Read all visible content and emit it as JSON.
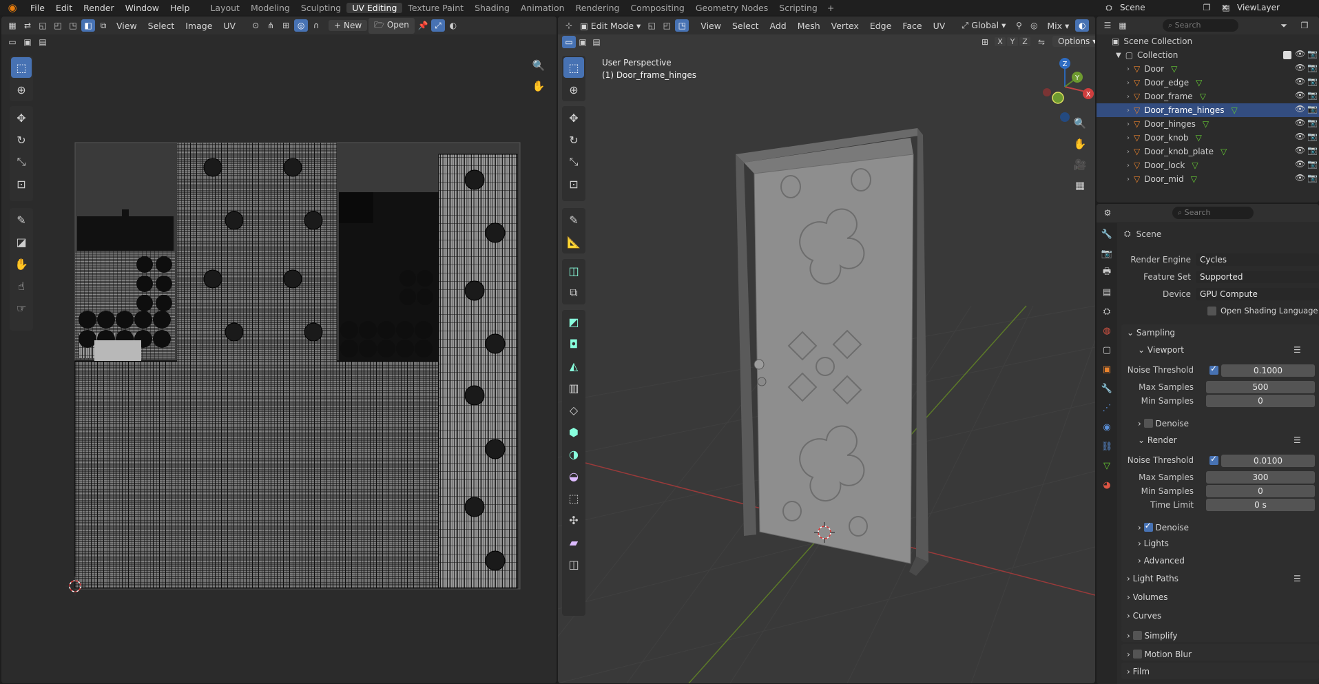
{
  "topbar": {
    "menus": [
      "File",
      "Edit",
      "Render",
      "Window",
      "Help"
    ],
    "workspaces": [
      {
        "label": "Layout",
        "active": false
      },
      {
        "label": "Modeling",
        "active": false
      },
      {
        "label": "Sculpting",
        "active": false
      },
      {
        "label": "UV Editing",
        "active": true
      },
      {
        "label": "Texture Paint",
        "active": false
      },
      {
        "label": "Shading",
        "active": false
      },
      {
        "label": "Animation",
        "active": false
      },
      {
        "label": "Rendering",
        "active": false
      },
      {
        "label": "Compositing",
        "active": false
      },
      {
        "label": "Geometry Nodes",
        "active": false
      },
      {
        "label": "Scripting",
        "active": false
      }
    ],
    "add_tab": "+",
    "scene": "Scene",
    "view_layer": "ViewLayer"
  },
  "uv_editor": {
    "menus": [
      "View",
      "Select",
      "Image",
      "UV"
    ],
    "new_label": "New",
    "open_label": "Open"
  },
  "viewport": {
    "mode": "Edit Mode",
    "menus": [
      "View",
      "Select",
      "Add",
      "Mesh",
      "Vertex",
      "Edge",
      "Face",
      "UV"
    ],
    "orientation": "Global",
    "mix": "Mix",
    "options": "Options",
    "axes": [
      "X",
      "Y",
      "Z"
    ],
    "perspective": "User Perspective",
    "object": "(1) Door_frame_hinges",
    "gizmo": {
      "x": "X",
      "y": "Y",
      "z": "Z"
    }
  },
  "outliner": {
    "search_placeholder": "Search",
    "scene_collection": "Scene Collection",
    "collection": "Collection",
    "items": [
      {
        "name": "Door",
        "selected": false
      },
      {
        "name": "Door_edge",
        "selected": false
      },
      {
        "name": "Door_frame",
        "selected": false
      },
      {
        "name": "Door_frame_hinges",
        "selected": true
      },
      {
        "name": "Door_hinges",
        "selected": false
      },
      {
        "name": "Door_knob",
        "selected": false
      },
      {
        "name": "Door_knob_plate",
        "selected": false
      },
      {
        "name": "Door_lock",
        "selected": false
      },
      {
        "name": "Door_mid",
        "selected": false
      }
    ]
  },
  "properties": {
    "search_placeholder": "Search",
    "context": "Scene",
    "render_engine_label": "Render Engine",
    "render_engine": "Cycles",
    "feature_set_label": "Feature Set",
    "feature_set": "Supported",
    "device_label": "Device",
    "device": "GPU Compute",
    "osl_label": "Open Shading Language",
    "sampling": "Sampling",
    "viewport": "Viewport",
    "vp_noise_label": "Noise Threshold",
    "vp_noise": "0.1000",
    "vp_max_label": "Max Samples",
    "vp_max": "500",
    "vp_min_label": "Min Samples",
    "vp_min": "0",
    "vp_denoise": "Denoise",
    "render": "Render",
    "r_noise_label": "Noise Threshold",
    "r_noise": "0.0100",
    "r_max_label": "Max Samples",
    "r_max": "300",
    "r_min_label": "Min Samples",
    "r_min": "0",
    "r_time_label": "Time Limit",
    "r_time": "0 s",
    "r_denoise": "Denoise",
    "lights": "Lights",
    "advanced": "Advanced",
    "light_paths": "Light Paths",
    "volumes": "Volumes",
    "curves": "Curves",
    "simplify": "Simplify",
    "motion_blur": "Motion Blur",
    "film": "Film"
  },
  "colors": {
    "accent": "#4772b3",
    "background": "#1d1d1d",
    "panel": "#2b2b2b",
    "mesh_orange": "#e8822d"
  }
}
